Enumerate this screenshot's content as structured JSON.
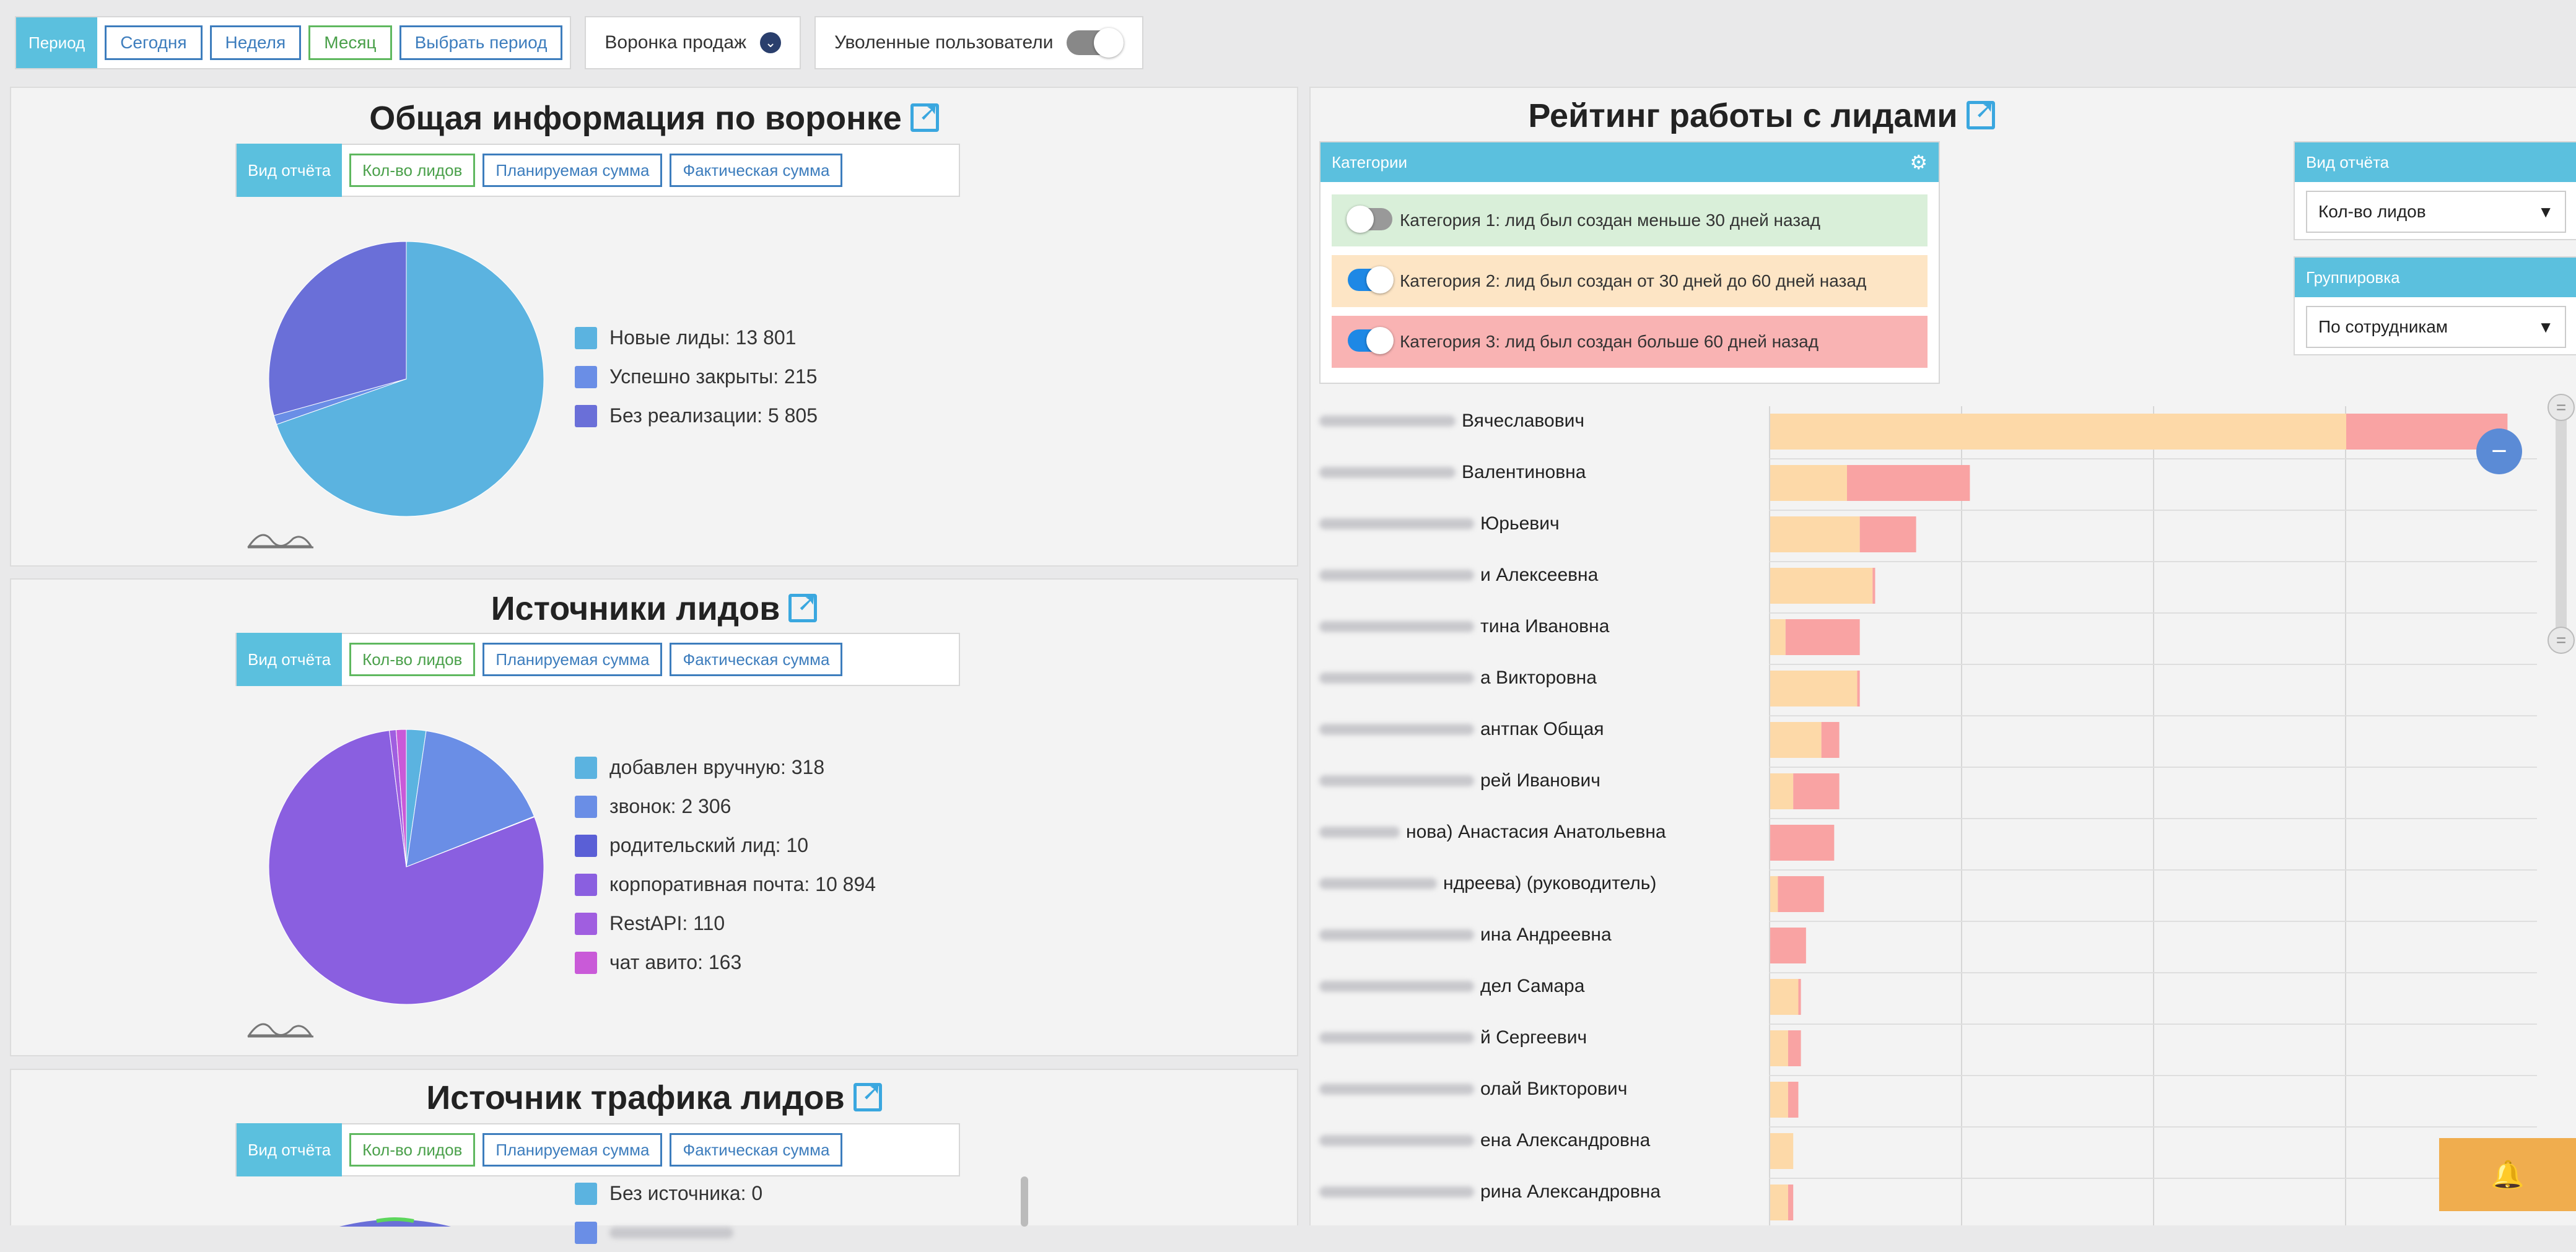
{
  "toolbar": {
    "period_tag": "Период",
    "period_buttons": [
      "Сегодня",
      "Неделя",
      "Месяц",
      "Выбрать период"
    ],
    "funnel_select": "Воронка продаж",
    "fired_users_label": "Уволенные пользователи"
  },
  "view_bar": {
    "tag": "Вид отчёта",
    "buttons": [
      "Кол-во лидов",
      "Планируемая сумма",
      "Фактическая сумма"
    ]
  },
  "funnel_panel": {
    "title": "Общая информация по воронке",
    "legend": [
      {
        "label": "Новые лиды:",
        "value": "13 801"
      },
      {
        "label": "Успешно закрыты:",
        "value": "215"
      },
      {
        "label": "Без реализации:",
        "value": "5 805"
      }
    ]
  },
  "sources_panel": {
    "title": "Источники лидов",
    "legend": [
      {
        "label": "добавлен вручную:",
        "value": "318"
      },
      {
        "label": "звонок:",
        "value": "2 306"
      },
      {
        "label": "родительский лид:",
        "value": "10"
      },
      {
        "label": "корпоративная почта:",
        "value": "10 894"
      },
      {
        "label": "RestAPI:",
        "value": "110"
      },
      {
        "label": "чат авито:",
        "value": "163"
      }
    ]
  },
  "traffic_panel": {
    "title": "Источник трафика лидов",
    "legend": [
      {
        "label": "Без источника:",
        "value": "0"
      }
    ]
  },
  "rating_panel": {
    "title": "Рейтинг работы с лидами",
    "categories_title": "Категории",
    "categories": [
      {
        "label": "Категория 1: лид был создан меньше 30 дней назад",
        "enabled": false
      },
      {
        "label": "Категория 2: лид был создан от 30 дней до 60 дней назад",
        "enabled": true
      },
      {
        "label": "Категория 3: лид был создан больше 60 дней назад",
        "enabled": true
      }
    ],
    "report_view_title": "Вид отчёта",
    "report_view_value": "Кол-во лидов",
    "grouping_title": "Группировка",
    "grouping_value": "По сотрудникам",
    "employees": [
      "Вячеславович",
      "Валентиновна",
      "Юрьевич",
      "и Алексеевна",
      "тина Ивановна",
      "а Викторовна",
      "антпак Общая",
      "рей Иванович",
      "нова) Анастасия Анатольевна",
      "ндреева) (руководитель)",
      "ина Андреевна",
      "дел Самара",
      "й Сергеевич",
      "олай Викторович",
      "ена Александровна",
      "рина Александровна"
    ]
  },
  "colors": {
    "accent": "#5bc0de",
    "link": "#3d7dbd",
    "cat2": "#fdd9a8",
    "cat3": "#f9a3a3",
    "bell": "#f0ad4e"
  },
  "chart_data": [
    {
      "type": "pie",
      "categories": [
        "Новые лиды",
        "Успешно закрыты",
        "Без реализации"
      ],
      "values": [
        13801,
        215,
        5805
      ],
      "colors": [
        "#5bb3e0",
        "#6a8ee6",
        "#6a6fd8"
      ]
    },
    {
      "type": "pie",
      "categories": [
        "добавлен вручную",
        "звонок",
        "родительский лид",
        "корпоративная почта",
        "RestAPI",
        "чат авито"
      ],
      "values": [
        318,
        2306,
        10,
        10894,
        110,
        163
      ],
      "colors": [
        "#5bb3e0",
        "#6a8ee6",
        "#5a5fd6",
        "#8a5fe0",
        "#a05ee0",
        "#c95ad8"
      ]
    },
    {
      "type": "bar",
      "stacked": true,
      "orientation": "horizontal",
      "categories": [
        "Вячеславович",
        "Валентиновна",
        "Юрьевич",
        "и Алексеевна",
        "тина Ивановна",
        "а Викторовна",
        "антпак Общая",
        "рей Иванович",
        "нова) Анастасия Анатольевна",
        "ндреева) (руководитель)",
        "ина Андреевна",
        "дел Самара",
        "й Сергеевич",
        "олай Викторович",
        "ена Александровна",
        "рина Александровна"
      ],
      "series": [
        {
          "name": "Категория 2: лид был создан от 30 дней до 60 дней назад",
          "values": [
            225,
            30,
            35,
            40,
            6,
            34,
            20,
            9,
            0,
            3,
            0,
            11,
            7,
            7,
            9,
            7
          ]
        },
        {
          "name": "Категория 3: лид был создан больше 60 дней назад",
          "values": [
            63,
            48,
            22,
            1,
            29,
            1,
            7,
            18,
            25,
            18,
            14,
            1,
            5,
            4,
            0,
            2
          ]
        }
      ],
      "xlim": [
        0,
        300
      ]
    }
  ]
}
